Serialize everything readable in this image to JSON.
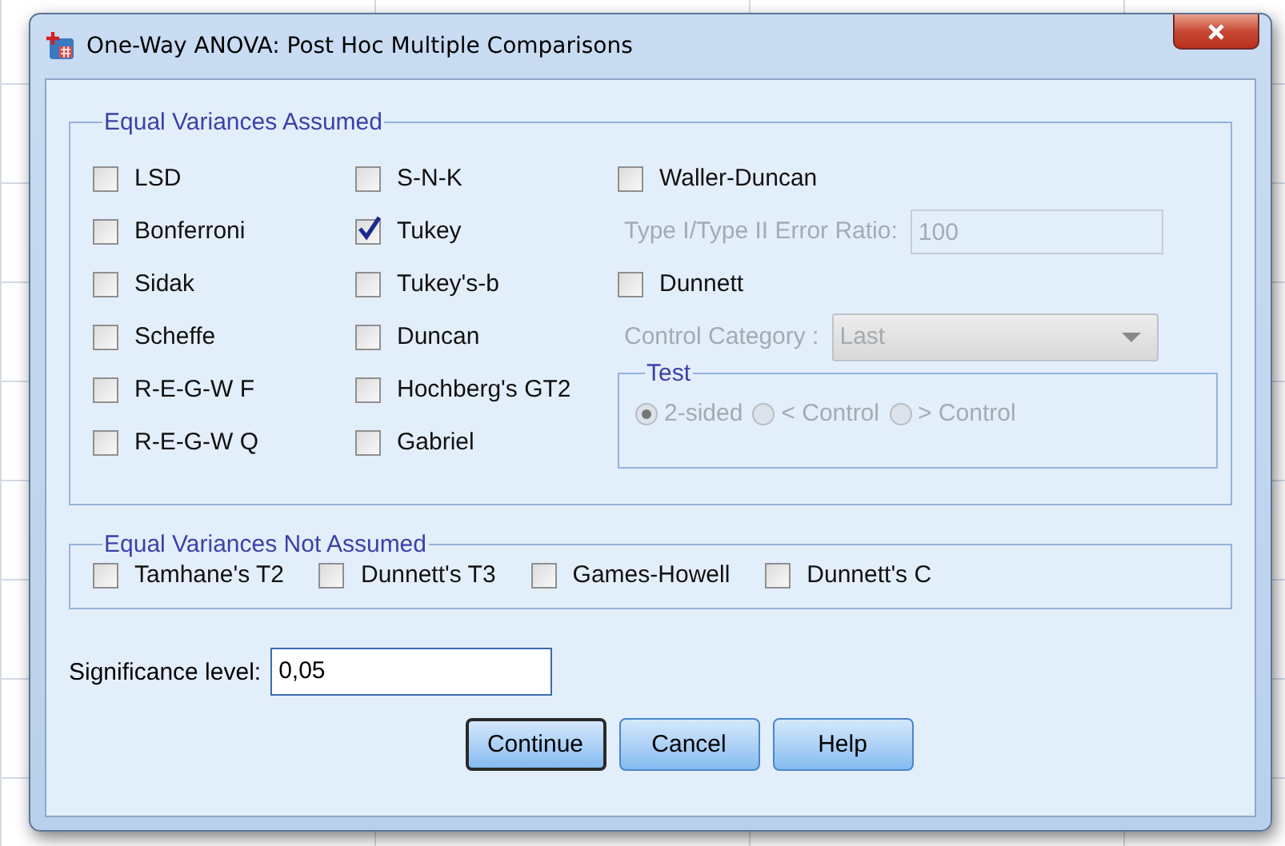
{
  "window": {
    "title": "One-Way ANOVA: Post Hoc Multiple Comparisons"
  },
  "equal_variances_assumed": {
    "title": "Equal Variances Assumed",
    "columns": [
      [
        {
          "label": "LSD",
          "checked": false
        },
        {
          "label": "Bonferroni",
          "checked": false
        },
        {
          "label": "Sidak",
          "checked": false
        },
        {
          "label": "Scheffe",
          "checked": false
        },
        {
          "label": "R-E-G-W F",
          "checked": false
        },
        {
          "label": "R-E-G-W Q",
          "checked": false
        }
      ],
      [
        {
          "label": "S-N-K",
          "checked": false
        },
        {
          "label": "Tukey",
          "checked": true
        },
        {
          "label": "Tukey's-b",
          "checked": false
        },
        {
          "label": "Duncan",
          "checked": false
        },
        {
          "label": "Hochberg's GT2",
          "checked": false
        },
        {
          "label": "Gabriel",
          "checked": false
        }
      ]
    ],
    "waller_duncan": {
      "label": "Waller-Duncan",
      "checked": false
    },
    "error_ratio": {
      "label": "Type I/Type II Error Ratio:",
      "value": "100",
      "disabled": true
    },
    "dunnett": {
      "label": "Dunnett",
      "checked": false
    },
    "control_category": {
      "label": "Control Category :",
      "value": "Last",
      "disabled": true
    },
    "test": {
      "title": "Test",
      "disabled": true,
      "options": [
        {
          "label": "2-sided",
          "selected": true
        },
        {
          "label": "< Control",
          "selected": false
        },
        {
          "label": "> Control",
          "selected": false
        }
      ]
    }
  },
  "equal_variances_not_assumed": {
    "title": "Equal Variances Not Assumed",
    "options": [
      {
        "label": "Tamhane's T2",
        "checked": false
      },
      {
        "label": "Dunnett's T3",
        "checked": false
      },
      {
        "label": "Games-Howell",
        "checked": false
      },
      {
        "label": "Dunnett's C",
        "checked": false
      }
    ]
  },
  "significance_level": {
    "label": "Significance level:",
    "value": "0,05"
  },
  "buttons": [
    {
      "label": "Continue",
      "default": true
    },
    {
      "label": "Cancel",
      "default": false
    },
    {
      "label": "Help",
      "default": false
    }
  ]
}
